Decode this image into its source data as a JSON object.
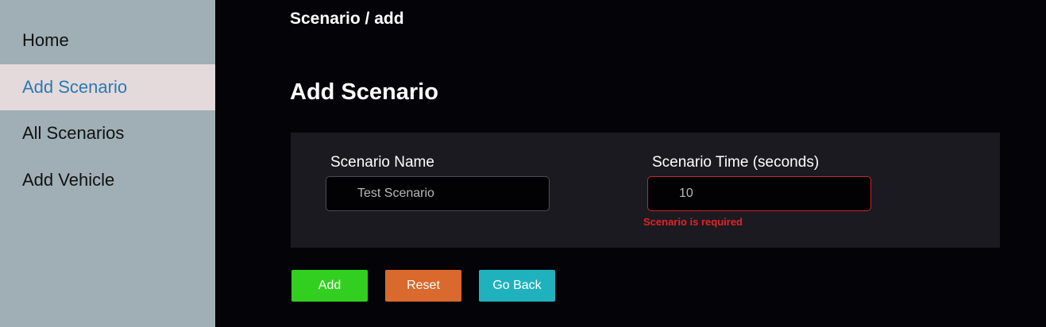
{
  "sidebar": {
    "items": [
      {
        "label": "Home",
        "active": false
      },
      {
        "label": "Add Scenario",
        "active": true
      },
      {
        "label": "All Scenarios",
        "active": false
      },
      {
        "label": "Add Vehicle",
        "active": false
      }
    ]
  },
  "header": {
    "breadcrumb": "Scenario / add",
    "title": "Add Scenario"
  },
  "form": {
    "name_label": "Scenario Name",
    "name_value": "Test Scenario",
    "time_label": "Scenario Time (seconds)",
    "time_value": "10",
    "time_error": "Scenario is required"
  },
  "actions": {
    "add_label": "Add",
    "reset_label": "Reset",
    "back_label": "Go Back"
  },
  "colors": {
    "sidebar_bg": "#9fafb5",
    "active_item_bg": "#e4dadb",
    "active_item_text": "#2a79b2",
    "error": "#e0242a",
    "add_button": "#33cf20",
    "reset_button": "#d9692d",
    "back_button": "#1fb2be"
  }
}
